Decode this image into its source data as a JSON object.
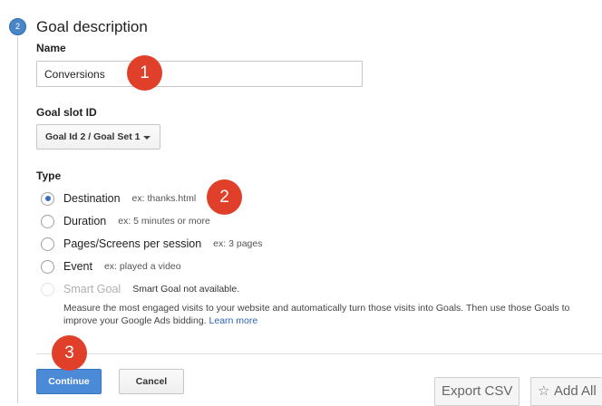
{
  "step": {
    "number": "2",
    "title": "Goal description"
  },
  "name_field": {
    "label": "Name",
    "value": "Conversions"
  },
  "goal_slot": {
    "label": "Goal slot ID",
    "selected": "Goal Id 2 / Goal Set 1"
  },
  "type": {
    "label": "Type",
    "options": [
      {
        "label": "Destination",
        "hint": "ex: thanks.html",
        "checked": true
      },
      {
        "label": "Duration",
        "hint": "ex: 5 minutes or more",
        "checked": false
      },
      {
        "label": "Pages/Screens per session",
        "hint": "ex: 3 pages",
        "checked": false
      },
      {
        "label": "Event",
        "hint": "ex: played a video",
        "checked": false
      },
      {
        "label": "Smart Goal",
        "hint": "Smart Goal not available.",
        "disabled": true
      }
    ],
    "smart_description": "Measure the most engaged visits to your website and automatically turn those visits into Goals. Then use those Goals to improve your Google Ads bidding.",
    "learn_more": "Learn more"
  },
  "buttons": {
    "continue": "Continue",
    "cancel": "Cancel",
    "export_csv": "Export CSV",
    "add_all": "Add All"
  },
  "annotations": [
    "1",
    "2",
    "3"
  ],
  "colors": {
    "primary": "#4a8ad6",
    "badge": "#e0402a",
    "link": "#2a62b8"
  }
}
